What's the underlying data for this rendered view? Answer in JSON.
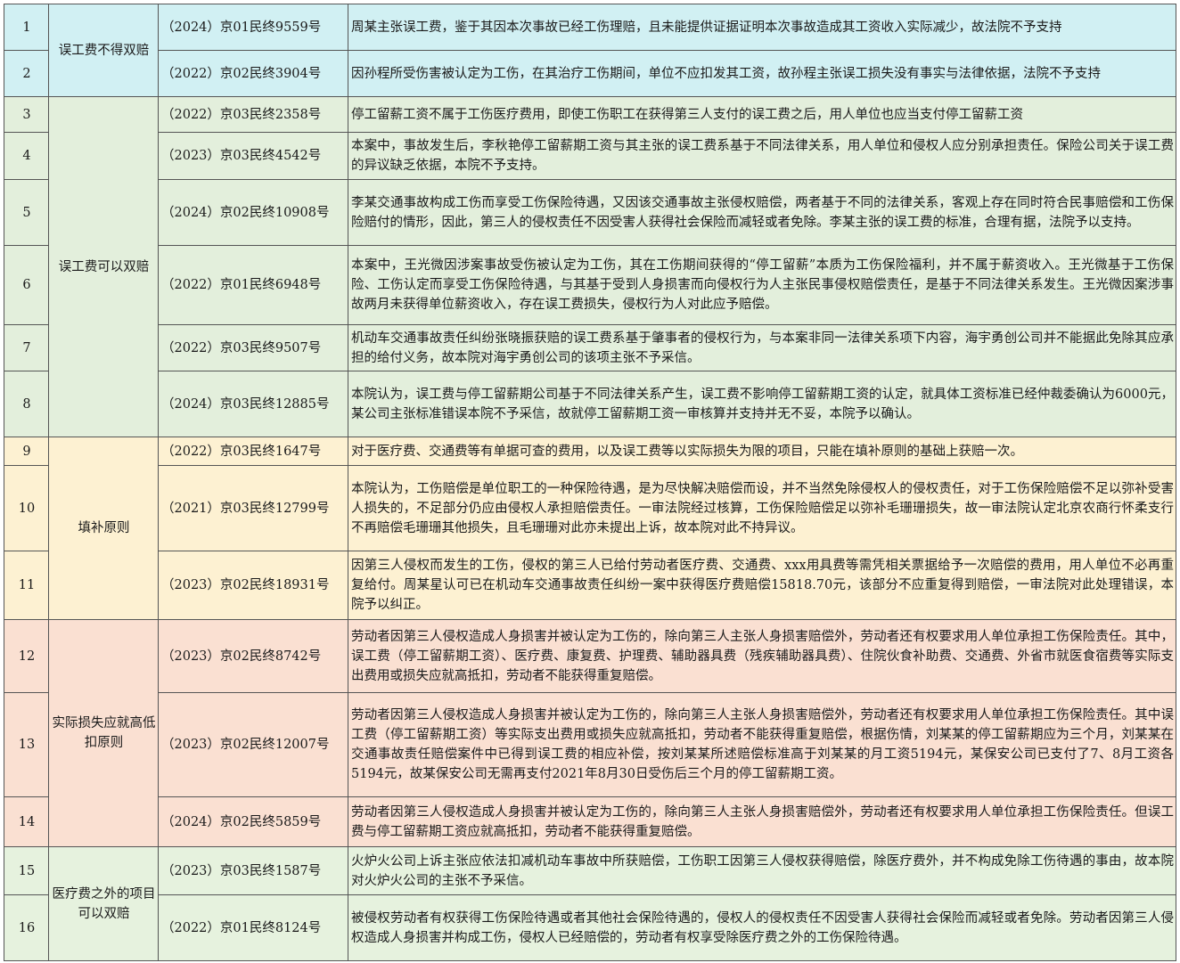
{
  "groups": [
    {
      "category": "误工费不得双赔",
      "color": "#d1f0f3",
      "rows": [
        {
          "no": "1",
          "case": "（2024）京01民终9559号",
          "text": "周某主张误工费，鉴于其因本次事故已经工伤理赔，且未能提供证据证明本次事故造成其工资收入实际减少，故法院不予支持"
        },
        {
          "no": "2",
          "case": "（2022）京02民终3904号",
          "text": "因孙程所受伤害被认定为工伤，在其治疗工伤期间，单位不应扣发其工资，故孙程主张误工损失没有事实与法律依据，法院不予支持"
        }
      ]
    },
    {
      "category": "误工费可以双赔",
      "color": "#e3efdc",
      "rows": [
        {
          "no": "3",
          "case": "（2022）京03民终2358号",
          "text": "停工留薪工资不属于工伤医疗费用，即使工伤职工在获得第三人支付的误工费之后，用人单位也应当支付停工留薪工资"
        },
        {
          "no": "4",
          "case": "（2023）京03民终4542号",
          "text": "本案中，事故发生后，李秋艳停工留薪期工资与其主张的误工费系基于不同法律关系，用人单位和侵权人应分别承担责任。保险公司关于误工费的异议缺乏依据，本院不予支持。"
        },
        {
          "no": "5",
          "case": "（2024）京02民终10908号",
          "text": "李某交通事故构成工伤而享受工伤保险待遇，又因该交通事故主张侵权赔偿，两者基于不同的法律关系，客观上存在同时符合民事赔偿和工伤保险赔付的情形，因此，第三人的侵权责任不因受害人获得社会保险而减轻或者免除。李某主张的误工费的标准，合理有据，法院予以支持。"
        },
        {
          "no": "6",
          "case": "（2022）京01民终6948号",
          "text": "本案中，王光微因涉案事故受伤被认定为工伤，其在工伤期间获得的“停工留薪”本质为工伤保险福利，并不属于薪资收入。王光微基于工伤保险、工伤认定而享受工伤保险待遇，与其基于受到人身损害而向侵权行为人主张民事侵权赔偿责任，是基于不同法律关系发生。王光微因案涉事故两月未获得单位薪资收入，存在误工费损失，侵权行为人对此应予赔偿。"
        },
        {
          "no": "7",
          "case": "（2022）京03民终9507号",
          "text": "机动车交通事故责任纠纷张晓振获赔的误工费系基于肇事者的侵权行为，与本案非同一法律关系项下内容，海宇勇创公司并不能据此免除其应承担的给付义务，故本院对海宇勇创公司的该项主张不予采信。"
        },
        {
          "no": "8",
          "case": "（2024）京03民终12885号",
          "text": "本院认为，误工费与停工留薪期公司基于不同法律关系产生，误工费不影响停工留薪期工资的认定，就具体工资标准已经仲裁委确认为6000元，某公司主张标准错误本院不予采信，故就停工留薪期工资一审核算并支持并无不妥，本院予以确认。"
        }
      ]
    },
    {
      "category": "填补原则",
      "color": "#fdf1d2",
      "rows": [
        {
          "no": "9",
          "case": "（2022）京03民终1647号",
          "text": "对于医疗费、交通费等有单据可查的费用，以及误工费等以实际损失为限的项目，只能在填补原则的基础上获赔一次。"
        },
        {
          "no": "10",
          "case": "（2021）京03民终12799号",
          "text": "本院认为，工伤赔偿是单位职工的一种保险待遇，是为尽快解决赔偿而设，并不当然免除侵权人的侵权责任，对于工伤保险赔偿不足以弥补受害人损失的，不足部分仍应由侵权人承担赔偿责任。一审法院经过核算，工伤保险赔偿足以弥补毛珊珊损失，故一审法院认定北京农商行怀柔支行不再赔偿毛珊珊其他损失，且毛珊珊对此亦未提出上诉，故本院对此不持异议。"
        },
        {
          "no": "11",
          "case": "（2023）京02民终18931号",
          "text": "因第三人侵权而发生的工伤，侵权的第三人已给付劳动者医疗费、交通费、xxx用具费等需凭相关票据给予一次赔偿的费用，用人单位不必再重复给付。周某星认可已在机动车交通事故责任纠纷一案中获得医疗费赔偿15818.70元，该部分不应重复得到赔偿，一审法院对此处理错误，本院予以纠正。"
        }
      ]
    },
    {
      "category": "实际损失应就高低扣原则",
      "color": "#fae0d2",
      "rows": [
        {
          "no": "12",
          "case": "（2023）京02民终8742号",
          "text": "劳动者因第三人侵权造成人身损害并被认定为工伤的，除向第三人主张人身损害赔偿外，劳动者还有权要求用人单位承担工伤保险责任。其中，误工费（停工留薪期工资）、医疗费、康复费、护理费、辅助器具费（残疾辅助器具费）、住院伙食补助费、交通费、外省市就医食宿费等实际支出费用或损失应就高抵扣，劳动者不能获得重复赔偿。"
        },
        {
          "no": "13",
          "case": "（2023）京02民终12007号",
          "text": "劳动者因第三人侵权造成人身损害并被认定为工伤的，除向第三人主张人身损害赔偿外，劳动者还有权要求用人单位承担工伤保险责任。其中误工费（停工留薪期工资）等实际支出费用或损失应就高抵扣，劳动者不能获得重复赔偿，根据伤情，刘某某的停工留薪期应为三个月，刘某某在交通事故责任赔偿案件中已得到误工费的相应补偿，按刘某某所述赔偿标准高于刘某某的月工资5194元，某保安公司已支付了7、8月工资各5194元，故某保安公司无需再支付2021年8月30日受伤后三个月的停工留薪期工资。"
        },
        {
          "no": "14",
          "case": "（2024）京02民终5859号",
          "text": "劳动者因第三人侵权造成人身损害并被认定为工伤的，除向第三人主张人身损害赔偿外，劳动者还有权要求用人单位承担工伤保险责任。但误工费与停工留薪期工资应就高抵扣，劳动者不能获得重复赔偿。"
        }
      ]
    },
    {
      "category": "医疗费之外的项目可以双赔",
      "color": "#e6f2de",
      "rows": [
        {
          "no": "15",
          "case": "（2023）京03民终1587号",
          "text": "火炉火公司上诉主张应依法扣减机动车事故中所获赔偿，工伤职工因第三人侵权获得赔偿，除医疗费外，并不构成免除工伤待遇的事由，故本院对火炉火公司的主张不予采信。"
        },
        {
          "no": "16",
          "case": "（2022）京01民终8124号",
          "text": "被侵权劳动者有权获得工伤保险待遇或者其他社会保险待遇的，侵权人的侵权责任不因受害人获得社会保险而减轻或者免除。劳动者因第三人侵权造成人身损害并构成工伤，侵权人已经赔偿的，劳动者有权享受除医疗费之外的工伤保险待遇。"
        }
      ]
    }
  ]
}
